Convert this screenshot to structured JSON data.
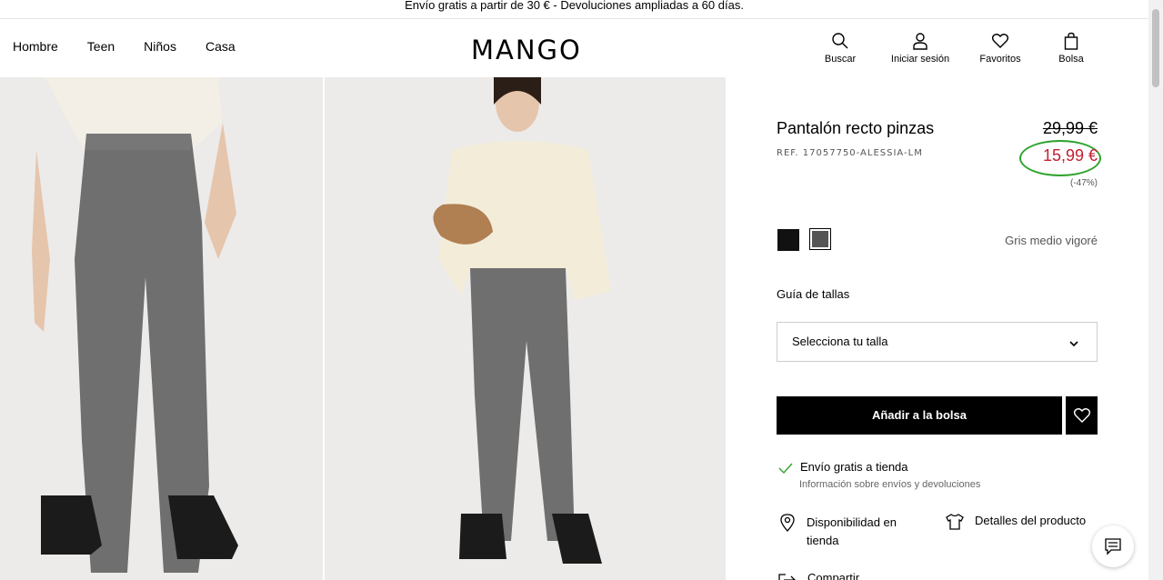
{
  "promo": "Envío gratis a partir de 30 € - Devoluciones ampliadas a 60 días.",
  "nav": {
    "items": [
      "Hombre",
      "Teen",
      "Niños",
      "Casa"
    ]
  },
  "brand": "MANGO",
  "actions": {
    "search": "Buscar",
    "login": "Iniciar sesión",
    "favorites": "Favoritos",
    "bag": "Bolsa"
  },
  "product": {
    "title": "Pantalón recto pinzas",
    "ref": "REF. 17057750-ALESSIA-LM",
    "old_price": "29,99 €",
    "new_price": "15,99 €",
    "discount": "(-47%)",
    "colour_name": "Gris medio vigoré",
    "colours": [
      "#111111",
      "#555555"
    ],
    "size_guide": "Guía de tallas",
    "size_placeholder": "Selecciona tu talla",
    "add_to_bag": "Añadir a la bolsa",
    "shipping_label": "Envío gratis a tienda",
    "shipping_sub": "Información sobre envíos y devoluciones",
    "availability": "Disponibilidad en tienda",
    "details": "Detalles del producto",
    "share": "Compartir"
  },
  "colors": {
    "sale_red": "#c21e2e",
    "highlight_green": "#2da32d"
  }
}
